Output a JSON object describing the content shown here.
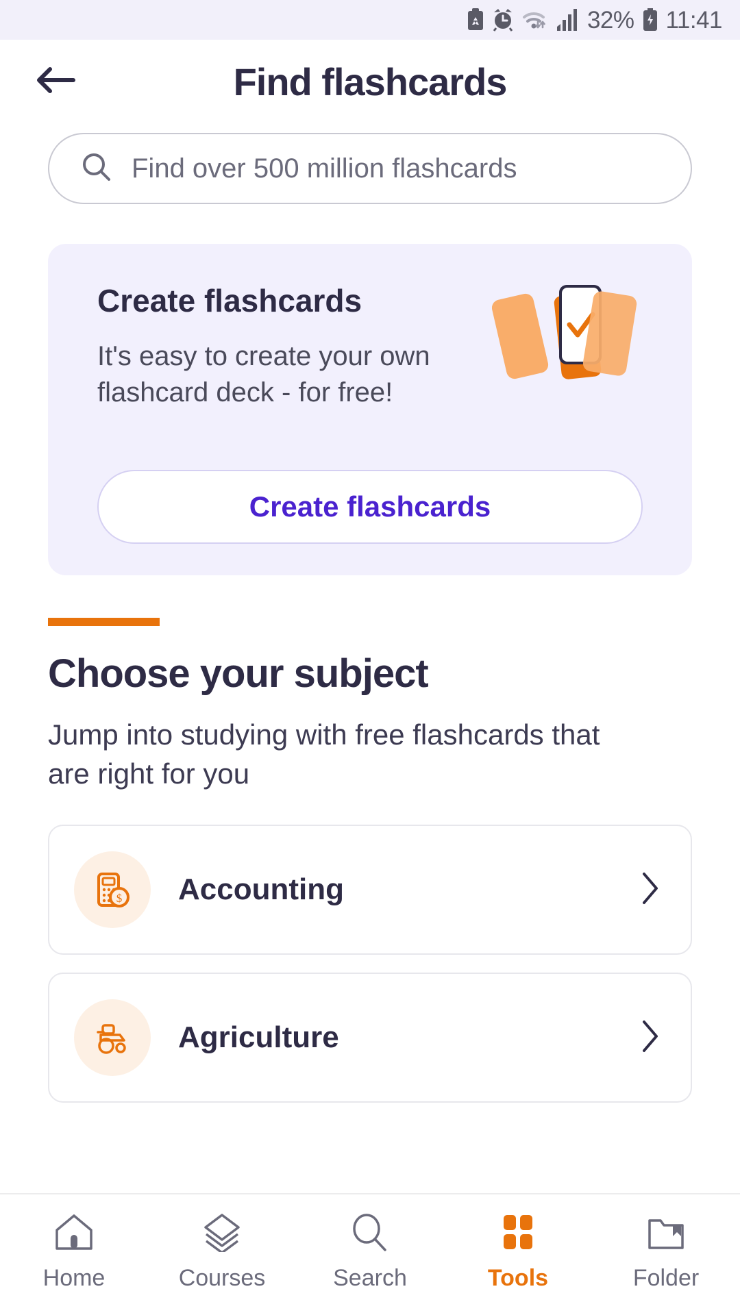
{
  "status_bar": {
    "icons": [
      "clipboard-recycle-icon",
      "alarm-clock-icon",
      "wifi-icon",
      "cellular-signal-icon"
    ],
    "battery_percent": "32%",
    "battery_icon": "battery-charging-icon",
    "time": "11:41"
  },
  "header": {
    "back_icon": "back-arrow-icon",
    "title": "Find flashcards"
  },
  "search": {
    "icon": "search-icon",
    "placeholder": "Find over 500 million flashcards",
    "value": ""
  },
  "promo": {
    "title": "Create flashcards",
    "description": "It's easy to create your own flashcard deck - for free!",
    "button_label": "Create flashcards",
    "illustration": "flashcard-deck-check-illustration",
    "background_color": "#f2f0fd",
    "button_text_color": "#4a22cf"
  },
  "subject_section": {
    "accent_color": "#e8730c",
    "title": "Choose your subject",
    "subtitle": "Jump into studying with free flashcards that are right for you",
    "items": [
      {
        "label": "Accounting",
        "icon": "calculator-dollar-icon",
        "chevron": "chevron-right-icon"
      },
      {
        "label": "Agriculture",
        "icon": "tractor-icon",
        "chevron": "chevron-right-icon"
      }
    ]
  },
  "bottom_nav": {
    "active_color": "#e8730c",
    "inactive_color": "#6b6b7b",
    "items": [
      {
        "label": "Home",
        "icon": "home-icon",
        "active": false
      },
      {
        "label": "Courses",
        "icon": "layers-icon",
        "active": false
      },
      {
        "label": "Search",
        "icon": "search-icon",
        "active": false
      },
      {
        "label": "Tools",
        "icon": "grid-squares-icon",
        "active": true
      },
      {
        "label": "Folder",
        "icon": "folder-bookmark-icon",
        "active": false
      }
    ]
  }
}
